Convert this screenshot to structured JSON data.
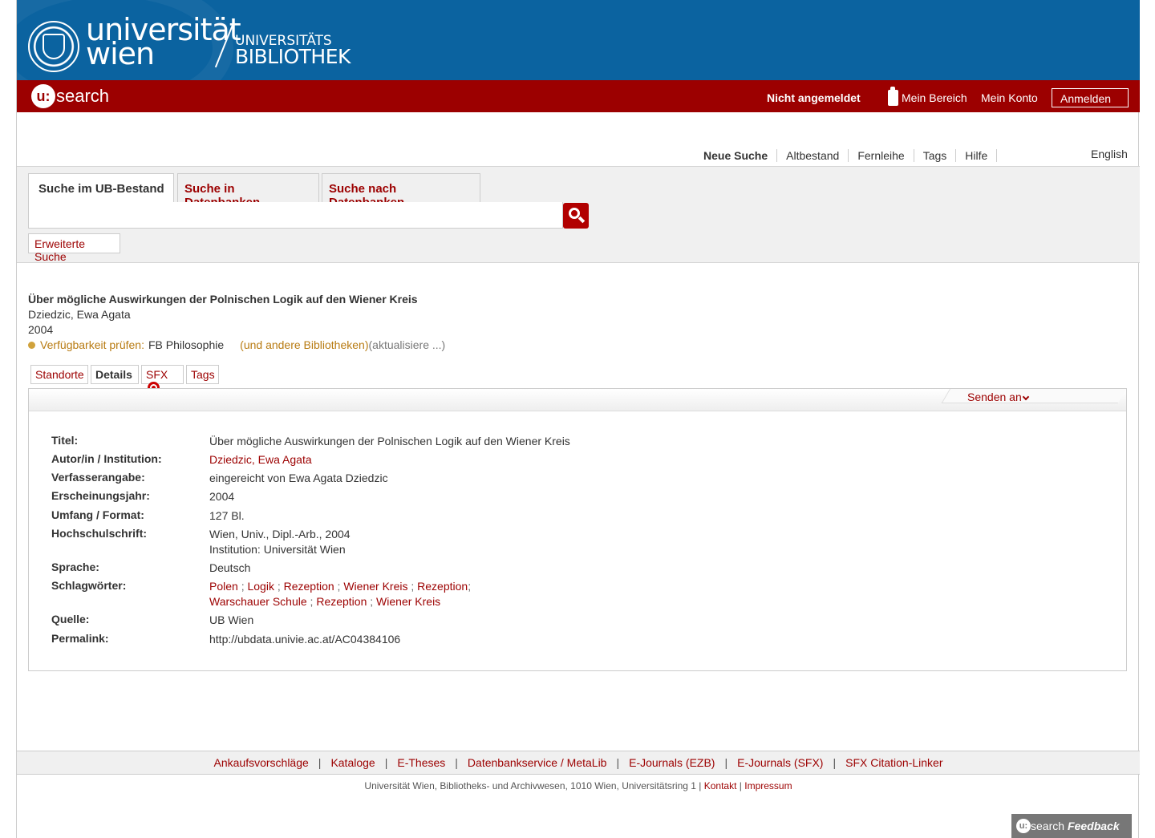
{
  "header": {
    "uni_line1": "universität",
    "uni_line2": "wien",
    "ub_line1": "UNIVERSITÄTS",
    "ub_line2": "BIBLIOTHEK"
  },
  "usearch": {
    "logo_u": "u:",
    "logo_text": "search",
    "status": "Nicht angemeldet",
    "my_area": "Mein Bereich",
    "my_account": "Mein Konto",
    "login": "Anmelden"
  },
  "topnav": {
    "items": [
      "Neue Suche",
      "Altbestand",
      "Fernleihe",
      "Tags",
      "Hilfe"
    ],
    "language": "English"
  },
  "search": {
    "tabs": [
      "Suche im UB-Bestand",
      "Suche in Datenbanken",
      "Suche nach Datenbanken"
    ],
    "query": "",
    "advanced": "Erweiterte Suche"
  },
  "record": {
    "title": "Über mögliche Auswirkungen der Polnischen Logik auf den Wiener Kreis",
    "author": "Dziedzic, Ewa Agata",
    "year": "2004",
    "availability_link": "Verfügbarkeit prüfen:",
    "location": "FB Philosophie",
    "other_libraries": "(und andere Bibliotheken)",
    "updating": "(aktualisiere ...)",
    "tabs": [
      "Standorte",
      "Details",
      "SFX",
      "Tags"
    ],
    "send_to": "Senden an"
  },
  "details": {
    "labels": {
      "titel": "Titel:",
      "autor": "Autor/in / Institution:",
      "verfasser": "Verfasserangabe:",
      "jahr": "Erscheinungsjahr:",
      "umfang": "Umfang / Format:",
      "hochschul": "Hochschulschrift:",
      "sprache": "Sprache:",
      "schlag": "Schlagwörter:",
      "quelle": "Quelle:",
      "permalink": "Permalink:"
    },
    "values": {
      "titel": "Über mögliche Auswirkungen der Polnischen Logik auf den Wiener Kreis",
      "autor": "Dziedzic, Ewa Agata",
      "verfasser": "eingereicht von Ewa Agata Dziedzic",
      "jahr": "2004",
      "umfang": "127 Bl.",
      "hochschul_line1": "Wien, Univ., Dipl.-Arb., 2004",
      "hochschul_line2": "Institution: Universität Wien",
      "sprache": "Deutsch",
      "quelle": "UB Wien",
      "permalink": "http://ubdata.univie.ac.at/AC04384106"
    },
    "subjects_line1": [
      "Polen",
      "Logik",
      "Rezeption",
      "Wiener Kreis",
      "Rezeption"
    ],
    "subjects_line2": [
      "Warschauer Schule",
      "Rezeption",
      "Wiener Kreis"
    ]
  },
  "footer": {
    "links": [
      "Ankaufsvorschläge",
      "Kataloge",
      "E-Theses",
      "Datenbankservice / MetaLib",
      "E-Journals (EZB)",
      "E-Journals (SFX)",
      "SFX Citation-Linker"
    ],
    "address": "Universität Wien, Bibliotheks- und Archivwesen, 1010 Wien, Universitätsring 1 |",
    "contact": "Kontakt",
    "imprint": "Impressum",
    "sep": "|"
  },
  "feedback": {
    "logo_u": "u:",
    "logo_text": "search",
    "label": "Feedback"
  }
}
